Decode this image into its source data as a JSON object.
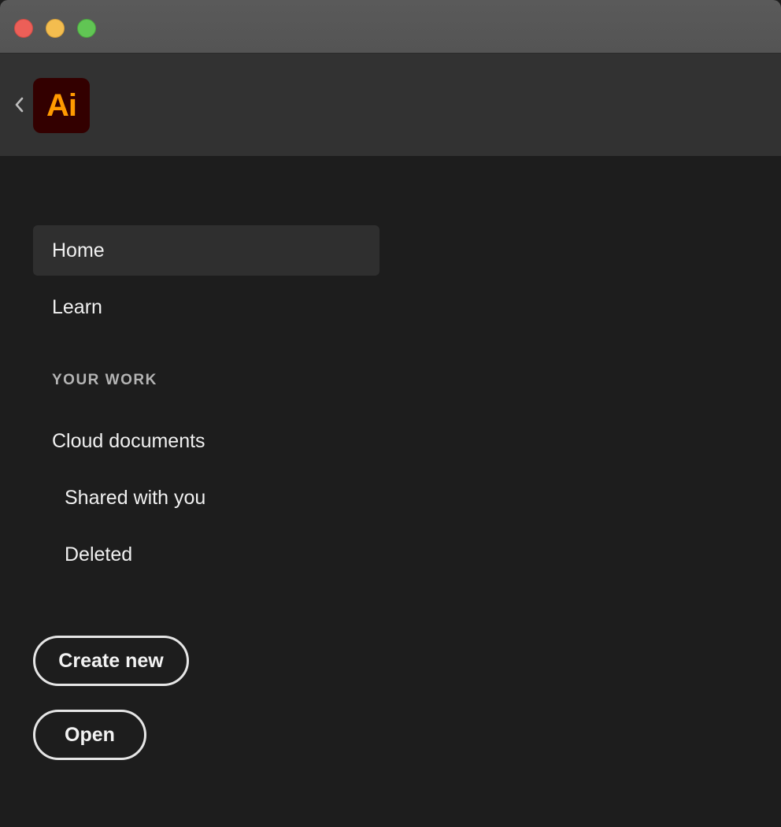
{
  "window": {
    "controls": [
      "close",
      "minimize",
      "zoom"
    ],
    "colors": {
      "close": "#ec5f58",
      "minimize": "#f3bd4f",
      "zoom": "#61c554",
      "background": "#1d1d1d",
      "appbar": "#323232"
    }
  },
  "appbar": {
    "back_icon": "chevron-left-icon",
    "logo_text": "Ai",
    "logo_colors": {
      "background": "#330000",
      "text": "#ff9a00"
    }
  },
  "sidebar": {
    "items": [
      {
        "label": "Home",
        "active": true
      },
      {
        "label": "Learn",
        "active": false
      }
    ],
    "section_header": "YOUR WORK",
    "work_items": [
      {
        "label": "Cloud documents"
      },
      {
        "label": "Shared with you"
      },
      {
        "label": "Deleted"
      }
    ]
  },
  "actions": {
    "create_new": "Create new",
    "open": "Open"
  }
}
